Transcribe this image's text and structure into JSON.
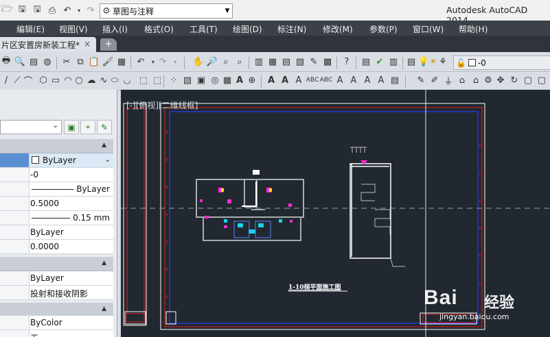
{
  "window": {
    "app_title": "Autodesk AutoCAD 2014",
    "workspace": "草图与注释"
  },
  "menu": [
    "编辑(E)",
    "视图(V)",
    "插入(I)",
    "格式(O)",
    "工具(T)",
    "绘图(D)",
    "标注(N)",
    "修改(M)",
    "参数(P)",
    "窗口(W)",
    "帮助(H)"
  ],
  "tabs": {
    "document": "片区安置房新装工程*",
    "close": "×",
    "new_tab": "+"
  },
  "layer_combo": {
    "value": "-0"
  },
  "properties": {
    "rows1": [
      {
        "name": "color",
        "value": "ByLayer",
        "highlight": true
      },
      {
        "name": "layer",
        "value": "-0"
      },
      {
        "name": "linetype",
        "value": "ByLayer",
        "line": true
      },
      {
        "name": "linetype-scale",
        "value": "0.5000"
      },
      {
        "name": "lineweight",
        "value": "0.15 mm",
        "line": true
      },
      {
        "name": "transparency",
        "value": "ByLayer"
      },
      {
        "name": "thickness",
        "value": "0.0000"
      }
    ],
    "rows2": [
      {
        "name": "material",
        "value": "ByLayer"
      },
      {
        "name": "shadow",
        "value": "投射和接收阴影"
      }
    ],
    "rows3": [
      {
        "name": "plot-style",
        "value": "ByColor"
      },
      {
        "name": "extra",
        "value": "无"
      }
    ]
  },
  "viewport": {
    "label": "[-][俯视][二维线框]",
    "drawing_title": "1-10梯平面施工图"
  },
  "watermark": {
    "brand": "Bai",
    "brand2": "经验",
    "url": "jingyan.baidu.com"
  },
  "colors": {
    "menubar_bg": "#3c4149",
    "canvas_bg": "#212830",
    "toolbar_bg": "#d9dee5",
    "accent_blue": "#5b8fd3"
  }
}
